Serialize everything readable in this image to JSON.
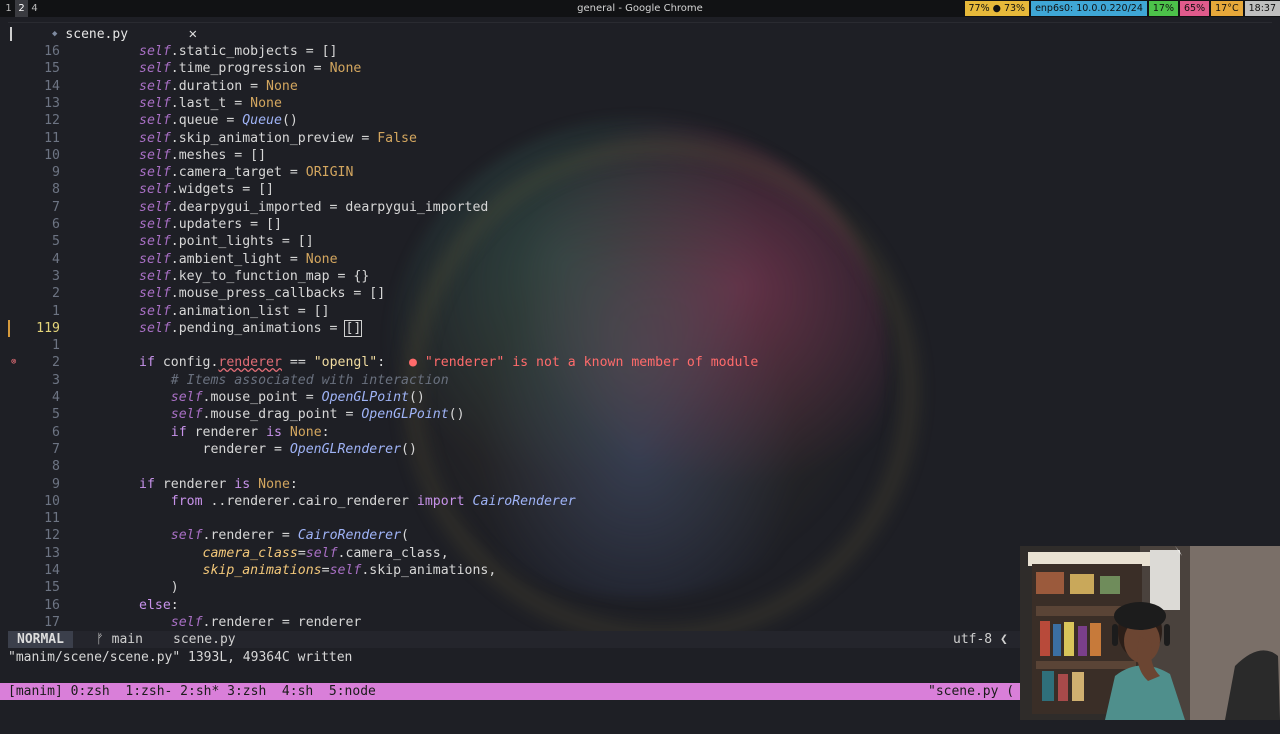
{
  "topbar": {
    "workspaces": [
      "1",
      "2",
      "4"
    ],
    "window_title": "general - Google Chrome",
    "tray": [
      {
        "text": "77% ● 73%",
        "color": "#e7b93a"
      },
      {
        "text": "enp6s0: 10.0.0.220/24",
        "color": "#3fa7d6"
      },
      {
        "text": "17%",
        "color": "#4cc24a"
      },
      {
        "text": "65%",
        "color": "#e05b8c"
      },
      {
        "text": "17°C",
        "color": "#e7a83a"
      },
      {
        "text": "18:37",
        "color": "#bfbfbf"
      }
    ]
  },
  "editor": {
    "tab_name": "scene.py",
    "lines": [
      {
        "n": "16",
        "segs": [
          [
            "self",
            "self"
          ],
          [
            ".static_mobjects = []",
            ""
          ]
        ]
      },
      {
        "n": "15",
        "segs": [
          [
            "self",
            "self"
          ],
          [
            ".time_progression = ",
            ""
          ],
          [
            "None",
            "const"
          ]
        ]
      },
      {
        "n": "14",
        "segs": [
          [
            "self",
            "self"
          ],
          [
            ".duration = ",
            ""
          ],
          [
            "None",
            "const"
          ]
        ]
      },
      {
        "n": "13",
        "segs": [
          [
            "self",
            "self"
          ],
          [
            ".last_t = ",
            ""
          ],
          [
            "None",
            "const"
          ]
        ]
      },
      {
        "n": "12",
        "segs": [
          [
            "self",
            "self"
          ],
          [
            ".queue = ",
            ""
          ],
          [
            "Queue",
            "cls"
          ],
          [
            "()",
            ""
          ]
        ]
      },
      {
        "n": "11",
        "segs": [
          [
            "self",
            "self"
          ],
          [
            ".skip_animation_preview = ",
            ""
          ],
          [
            "False",
            "const"
          ]
        ]
      },
      {
        "n": "10",
        "segs": [
          [
            "self",
            "self"
          ],
          [
            ".meshes = []",
            ""
          ]
        ]
      },
      {
        "n": "9",
        "segs": [
          [
            "self",
            "self"
          ],
          [
            ".camera_target = ",
            ""
          ],
          [
            "ORIGIN",
            "const"
          ]
        ]
      },
      {
        "n": "8",
        "segs": [
          [
            "self",
            "self"
          ],
          [
            ".widgets = []",
            ""
          ]
        ]
      },
      {
        "n": "7",
        "segs": [
          [
            "self",
            "self"
          ],
          [
            ".dearpygui_imported = dearpygui_imported",
            ""
          ]
        ]
      },
      {
        "n": "6",
        "segs": [
          [
            "self",
            "self"
          ],
          [
            ".updaters = []",
            ""
          ]
        ]
      },
      {
        "n": "5",
        "segs": [
          [
            "self",
            "self"
          ],
          [
            ".point_lights = []",
            ""
          ]
        ]
      },
      {
        "n": "4",
        "segs": [
          [
            "self",
            "self"
          ],
          [
            ".ambient_light = ",
            ""
          ],
          [
            "None",
            "const"
          ]
        ]
      },
      {
        "n": "3",
        "segs": [
          [
            "self",
            "self"
          ],
          [
            ".key_to_function_map = {}",
            ""
          ]
        ]
      },
      {
        "n": "2",
        "segs": [
          [
            "self",
            "self"
          ],
          [
            ".mouse_press_callbacks = []",
            ""
          ]
        ]
      },
      {
        "n": "1",
        "segs": [
          [
            "self",
            "self"
          ],
          [
            ".animation_list = []",
            ""
          ]
        ]
      },
      {
        "n": "119",
        "cur": true,
        "segs": [
          [
            "self",
            "self"
          ],
          [
            ".pending_animations = ",
            ""
          ],
          [
            "[]",
            "bracket-cur"
          ]
        ]
      },
      {
        "n": "1",
        "segs": []
      },
      {
        "n": "2",
        "err": true,
        "segs": [
          [
            "if",
            "kw"
          ],
          [
            " config.",
            ""
          ],
          [
            "renderer",
            "err"
          ],
          [
            " == ",
            ""
          ],
          [
            "\"opengl\"",
            "str"
          ],
          [
            ":   ",
            ""
          ],
          [
            "● \"renderer\" is not a known member of module",
            "diag"
          ]
        ]
      },
      {
        "n": "3",
        "segs": [
          [
            "    ",
            ""
          ],
          [
            "# Items associated with interaction",
            "cmt"
          ]
        ]
      },
      {
        "n": "4",
        "segs": [
          [
            "    ",
            ""
          ],
          [
            "self",
            "self"
          ],
          [
            ".mouse_point = ",
            ""
          ],
          [
            "OpenGLPoint",
            "cls"
          ],
          [
            "()",
            ""
          ]
        ]
      },
      {
        "n": "5",
        "segs": [
          [
            "    ",
            ""
          ],
          [
            "self",
            "self"
          ],
          [
            ".mouse_drag_point = ",
            ""
          ],
          [
            "OpenGLPoint",
            "cls"
          ],
          [
            "()",
            ""
          ]
        ]
      },
      {
        "n": "6",
        "segs": [
          [
            "    ",
            ""
          ],
          [
            "if",
            "kw"
          ],
          [
            " renderer ",
            ""
          ],
          [
            "is",
            "kw"
          ],
          [
            " ",
            ""
          ],
          [
            "None",
            "const"
          ],
          [
            ":",
            ""
          ]
        ]
      },
      {
        "n": "7",
        "segs": [
          [
            "        renderer = ",
            ""
          ],
          [
            "OpenGLRenderer",
            "cls"
          ],
          [
            "()",
            ""
          ]
        ]
      },
      {
        "n": "8",
        "segs": []
      },
      {
        "n": "9",
        "segs": [
          [
            "if",
            "kw"
          ],
          [
            " renderer ",
            ""
          ],
          [
            "is",
            "kw"
          ],
          [
            " ",
            ""
          ],
          [
            "None",
            "const"
          ],
          [
            ":",
            ""
          ]
        ]
      },
      {
        "n": "10",
        "segs": [
          [
            "    ",
            ""
          ],
          [
            "from",
            "kw"
          ],
          [
            " ..renderer.cairo_renderer ",
            ""
          ],
          [
            "import",
            "kw"
          ],
          [
            " ",
            ""
          ],
          [
            "CairoRenderer",
            "cls"
          ]
        ]
      },
      {
        "n": "11",
        "segs": []
      },
      {
        "n": "12",
        "segs": [
          [
            "    ",
            ""
          ],
          [
            "self",
            "self"
          ],
          [
            ".renderer = ",
            ""
          ],
          [
            "CairoRenderer",
            "cls"
          ],
          [
            "(",
            ""
          ]
        ]
      },
      {
        "n": "13",
        "segs": [
          [
            "        ",
            ""
          ],
          [
            "camera_class",
            "param"
          ],
          [
            "=",
            ""
          ],
          [
            "self",
            "self"
          ],
          [
            ".camera_class,",
            ""
          ]
        ]
      },
      {
        "n": "14",
        "segs": [
          [
            "        ",
            ""
          ],
          [
            "skip_animations",
            "param"
          ],
          [
            "=",
            ""
          ],
          [
            "self",
            "self"
          ],
          [
            ".skip_animations,",
            ""
          ]
        ]
      },
      {
        "n": "15",
        "segs": [
          [
            "    )",
            ""
          ]
        ]
      },
      {
        "n": "16",
        "segs": [
          [
            "else",
            "kw"
          ],
          [
            ":",
            ""
          ]
        ]
      },
      {
        "n": "17",
        "segs": [
          [
            "    ",
            ""
          ],
          [
            "self",
            "self"
          ],
          [
            ".renderer = renderer",
            ""
          ]
        ]
      }
    ]
  },
  "statusline": {
    "mode": "NORMAL",
    "branch": "ᚠ main",
    "file": "scene.py",
    "encoding": "utf-8 ❮"
  },
  "cmdline": "\"manim/scene/scene.py\" 1393L, 49364C written",
  "tmux": {
    "left": "[manim] 0:zsh  1:zsh- 2:sh* 3:zsh  4:sh  5:node",
    "right": "\"scene.py ("
  }
}
